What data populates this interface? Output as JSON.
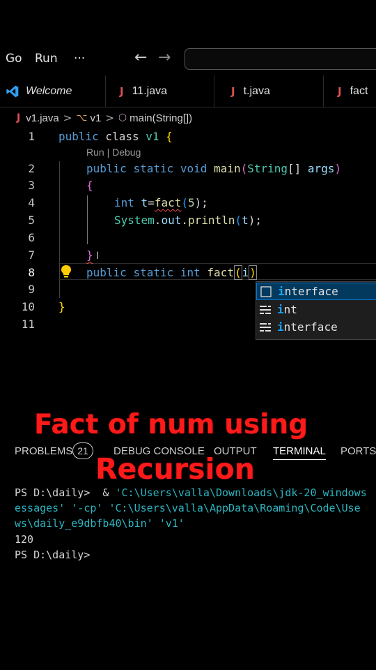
{
  "menubar": {
    "items": [
      "Go",
      "Run",
      "···"
    ],
    "back_arrow": "←",
    "forward_arrow": "→"
  },
  "tabs": [
    {
      "label": "Welcome",
      "icon": "vscode-logo-icon"
    },
    {
      "label": "11.java",
      "icon": "java-file-icon",
      "icon_glyph": "J"
    },
    {
      "label": "t.java",
      "icon": "java-file-icon",
      "icon_glyph": "J"
    },
    {
      "label": "fact",
      "icon": "java-file-icon",
      "icon_glyph": "J"
    }
  ],
  "breadcrumb": {
    "file": "v1.java",
    "class": "v1",
    "method": "main(String[])",
    "sep": ">"
  },
  "editor": {
    "line_numbers": [
      "1",
      "2",
      "3",
      "4",
      "5",
      "6",
      "7",
      "8",
      "9",
      "10",
      "11"
    ],
    "codelens": "Run | Debug",
    "lines": {
      "l1": [
        "public",
        " class ",
        "v1",
        " ",
        "{"
      ],
      "l2": [
        "public",
        " ",
        "static",
        " ",
        "void",
        " ",
        "main",
        "(",
        "String",
        "[] ",
        "args",
        ")"
      ],
      "l3": [
        "{"
      ],
      "l4": [
        "int",
        " ",
        "t",
        "=",
        "fact",
        "(",
        "5",
        ");"
      ],
      "l5": [
        "System",
        ".",
        "out",
        ".",
        "println",
        "(",
        "t",
        ");"
      ],
      "l7": [
        "}"
      ],
      "l8": [
        "public",
        " ",
        "static",
        " ",
        "int",
        " ",
        "fact",
        "(",
        "i",
        ")"
      ],
      "l10": [
        "}"
      ]
    }
  },
  "suggestions": [
    {
      "label_match": "i",
      "label_rest": "nterface",
      "icon": "keyword-snippet-icon",
      "selected": true
    },
    {
      "label_match": "i",
      "label_rest": "nt",
      "icon": "keyword-icon",
      "selected": false
    },
    {
      "label_match": "i",
      "label_rest": "nterface",
      "icon": "keyword-icon",
      "selected": false
    }
  ],
  "captions": {
    "line1": "Fact of num using",
    "line2": "Recursion"
  },
  "panel": {
    "tabs": [
      "PROBLEMS",
      "DEBUG CONSOLE",
      "OUTPUT",
      "TERMINAL",
      "PORTS"
    ],
    "problems_count": "21",
    "active_tab": "TERMINAL"
  },
  "terminal": {
    "line1_prompt": "PS D:\\daily>",
    "line1_cmd": "  & ",
    "line1_str": "'C:\\Users\\valla\\Downloads\\jdk-20_windows",
    "line2": "essages' '-cp' 'C:\\Users\\valla\\AppData\\Roaming\\Code\\Use",
    "line3": "ws\\daily_e9dbfb40\\bin' 'v1'",
    "line4": "120",
    "line5": "PS D:\\daily>"
  },
  "colors": {
    "caption": "#ff1a1a",
    "keyword": "#569cd6",
    "type": "#4ec9b0",
    "function": "#dcdcaa",
    "variable": "#9cdcfe",
    "terminal_string": "#2bb5c0"
  }
}
